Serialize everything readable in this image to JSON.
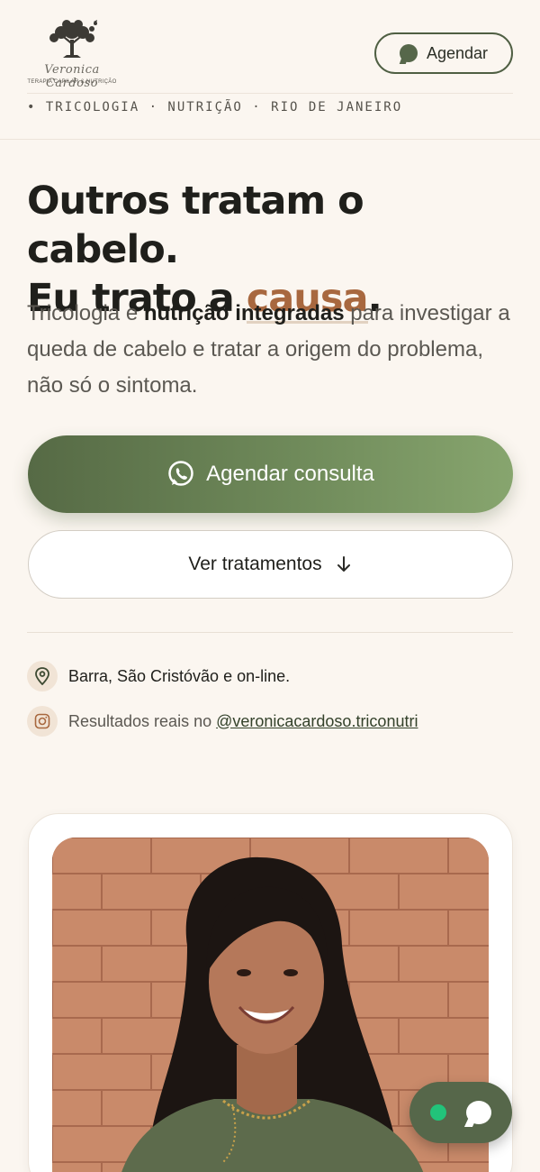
{
  "brand": {
    "name": "Veronica Cardoso",
    "tagline_small": "TERAPIA CAPILAR & NUTRIÇÃO"
  },
  "header": {
    "cta_label": "Agendar",
    "cta_icon": "chat-bubble-icon"
  },
  "tagline": "• TRICOLOGIA · NUTRIÇÃO · RIO DE JANEIRO",
  "hero": {
    "title_line1": "Outros tratam o cabelo.",
    "title_line2_prefix": "Eu trato a ",
    "title_line2_accent": "causa",
    "title_line2_suffix": ".",
    "text_prefix": "Tricologia e ",
    "text_bold": "nutrição integradas",
    "text_suffix": " para investigar a queda de cabelo e tratar a origem do problema, não só o sintoma."
  },
  "buttons": {
    "primary_label": "Agendar consulta",
    "primary_icon": "whatsapp-icon",
    "secondary_label": "Ver tratamentos",
    "secondary_icon": "arrow-down-icon"
  },
  "info": {
    "location": "Barra, São Cristóvão e on-line.",
    "location_icon": "map-pin-icon",
    "results_prefix": "Resultados reais no ",
    "instagram_handle": "@veronicacardoso.triconutri",
    "instagram_icon": "instagram-icon"
  },
  "float_chat": {
    "status": "online",
    "icon": "chat-bubble-icon"
  },
  "colors": {
    "background": "#fbf6f0",
    "primary_green": "#566a45",
    "accent_brown": "#a8683f",
    "online_green": "#22c37a"
  }
}
